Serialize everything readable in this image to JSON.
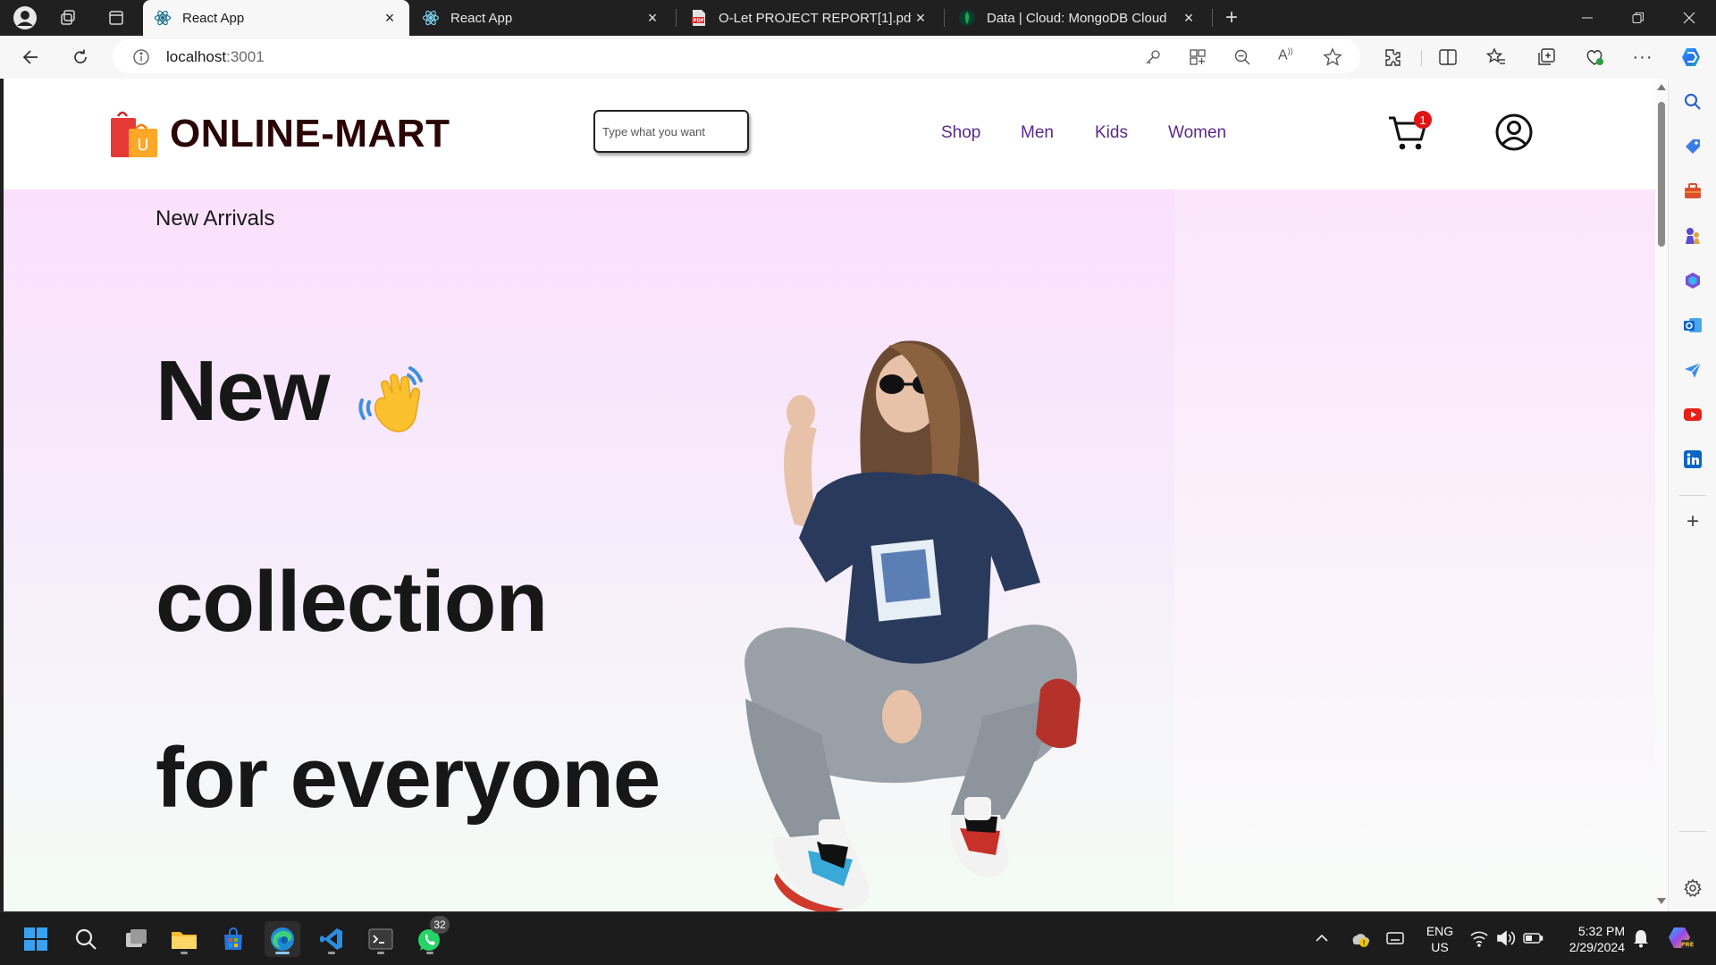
{
  "browser": {
    "tabs": [
      {
        "title": "React App",
        "active": true,
        "favicon": "react-icon"
      },
      {
        "title": "React App",
        "active": false,
        "favicon": "react-icon"
      },
      {
        "title": "O-Let PROJECT REPORT[1].pdf",
        "active": false,
        "favicon": "pdf-icon"
      },
      {
        "title": "Data | Cloud: MongoDB Cloud",
        "active": false,
        "favicon": "mongodb-leaf-icon"
      }
    ],
    "url_host": "localhost",
    "url_port": ":3001"
  },
  "site": {
    "brand": "ONLINE-MART",
    "logo_letter": "U",
    "search_placeholder": "Type what you want",
    "nav": [
      "Shop",
      "Men",
      "Kids",
      "Women"
    ],
    "cart_count": "1"
  },
  "hero": {
    "label": "New Arrivals",
    "line1": "New",
    "line2": "collection",
    "line3": "for everyone"
  },
  "taskbar": {
    "whatsapp_badge": "32",
    "lang_line1": "ENG",
    "lang_line2": "US",
    "time": "5:32 PM",
    "date": "2/29/2024"
  },
  "colors": {
    "brand_text": "#2b0505",
    "nav_link": "#5b2a8c",
    "cart_badge": "#e11414",
    "hero_top": "#fae0fc",
    "hero_bottom": "#f4fbf4"
  }
}
